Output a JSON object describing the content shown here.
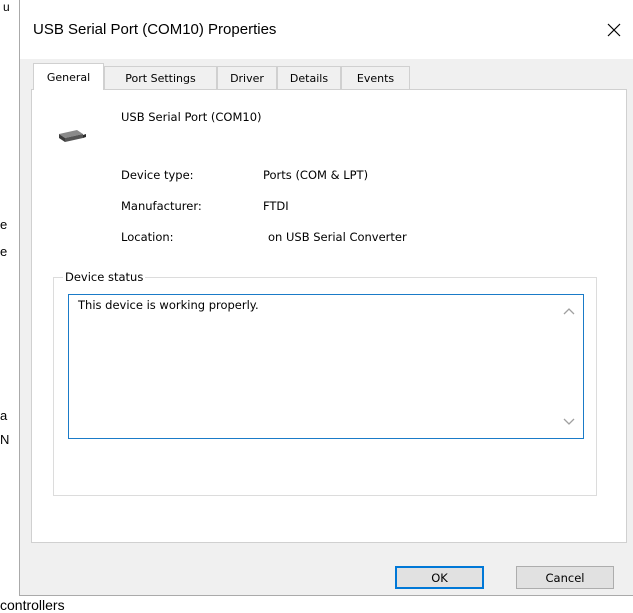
{
  "background": {
    "frag_u": "u",
    "frag_e1": "e",
    "frag_e2": "e",
    "frag_a": "a",
    "frag_n": "N",
    "frag_controllers": "controllers"
  },
  "dialog": {
    "title": "USB Serial Port (COM10) Properties",
    "close_glyph": "✕"
  },
  "tabs": [
    {
      "label": "General",
      "active": true
    },
    {
      "label": "Port Settings",
      "active": false
    },
    {
      "label": "Driver",
      "active": false
    },
    {
      "label": "Details",
      "active": false
    },
    {
      "label": "Events",
      "active": false
    }
  ],
  "general": {
    "device_name": "USB Serial Port (COM10)",
    "device_icon": "serial-cable-icon",
    "fields": [
      {
        "label": "Device type:",
        "value": "Ports (COM & LPT)"
      },
      {
        "label": "Manufacturer:",
        "value": "FTDI"
      },
      {
        "label": "Location:",
        "value": "on USB Serial Converter"
      }
    ],
    "status_group_label": "Device status",
    "status_text": "This device is working properly."
  },
  "buttons": {
    "ok": "OK",
    "cancel": "Cancel"
  },
  "colors": {
    "accent": "#0078d7",
    "dialog_bg": "#f0f0f0",
    "panel_bg": "#ffffff"
  }
}
